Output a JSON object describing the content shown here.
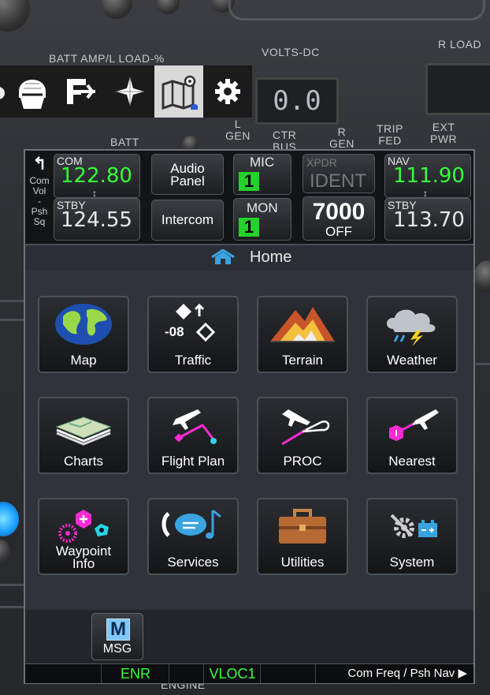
{
  "toolbar": {
    "items": [
      {
        "name": "partial-icon"
      },
      {
        "name": "pilot-helmet-icon"
      },
      {
        "name": "flight-plan-icon"
      },
      {
        "name": "compass-star-icon"
      },
      {
        "name": "map-icon",
        "active": true
      },
      {
        "name": "gear-icon"
      }
    ]
  },
  "cockpit": {
    "batt_amp_label": "BATT AMP/L LOAD-%",
    "volts_label": "VOLTS-DC",
    "rload_label": "R LOAD",
    "volts_display": "0.0",
    "batt_label": "BATT",
    "l_gen_label": "L\nGEN",
    "ctr_bus_label": "CTR\nBUS",
    "r_gen_label": "R\nGEN",
    "trip_fed_label": "TRIP\nFED",
    "ext_pwr_label": "EXT\nPWR",
    "engine_label": "ENGINE"
  },
  "radio": {
    "com_vol_label": [
      "Com",
      "Vol",
      "-",
      "Psh",
      "Sq"
    ],
    "com": {
      "label": "COM",
      "active": "122.80",
      "stby_label": "STBY",
      "standby": "124.55"
    },
    "audio_panel": "Audio\nPanel",
    "intercom": "Intercom",
    "mic": {
      "label": "MIC",
      "value": "1"
    },
    "mon": {
      "label": "MON",
      "value": "1"
    },
    "xpdr": {
      "label": "XPDR",
      "ident": "IDENT",
      "code": "7000",
      "mode": "OFF"
    },
    "nav": {
      "label": "NAV",
      "active": "111.90",
      "stby_label": "STBY",
      "standby": "113.70"
    }
  },
  "home": {
    "title": "Home"
  },
  "tiles": [
    {
      "label": "Map"
    },
    {
      "label": "Traffic",
      "value": "-08"
    },
    {
      "label": "Terrain"
    },
    {
      "label": "Weather"
    },
    {
      "label": "Charts"
    },
    {
      "label": "Flight Plan"
    },
    {
      "label": "PROC"
    },
    {
      "label": "Nearest"
    },
    {
      "label": "Waypoint\nInfo"
    },
    {
      "label": "Services"
    },
    {
      "label": "Utilities"
    },
    {
      "label": "System"
    }
  ],
  "msg": {
    "icon_letter": "M",
    "label": "MSG"
  },
  "status": {
    "enr": "ENR",
    "vloc": "VLOC1",
    "hint": "Com Freq / Psh Nav ▶"
  },
  "colors": {
    "active_green": "#35ff3a",
    "toolbar_active": "#d9d9d9",
    "magenta": "#ff2ad4",
    "cyan": "#2ad4e6"
  }
}
